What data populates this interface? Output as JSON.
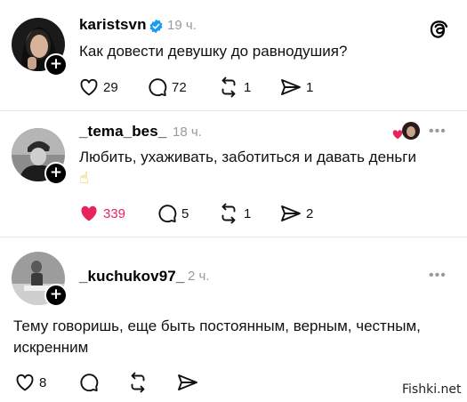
{
  "posts": [
    {
      "username": "karistsvn",
      "time": "19 ч.",
      "text": "Как довести девушку до равнодушия?",
      "likes": "29",
      "comments": "72",
      "reposts": "1",
      "shares": "1"
    },
    {
      "username": "_tema_bes_",
      "time": "18 ч.",
      "text": "Любить, ухаживать, заботиться и давать деньги",
      "emoji": "☝",
      "likes": "339",
      "comments": "5",
      "reposts": "1",
      "shares": "2"
    },
    {
      "username": "_kuchukov97_",
      "time": "2 ч.",
      "text": "Тему говоришь, еще быть постоянным, верным, честным, искренним",
      "likes": "8"
    }
  ],
  "watermark": "Fishki.net",
  "colors": {
    "like_red": "#e6245c",
    "verified_blue": "#1d9bf0",
    "muted": "#9a9a9a"
  }
}
